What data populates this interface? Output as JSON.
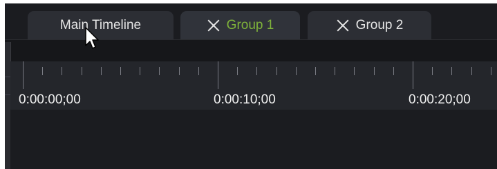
{
  "tabs": [
    {
      "label": "Main Timeline",
      "closable": false,
      "active": false
    },
    {
      "label": "Group 1",
      "closable": true,
      "active": true
    },
    {
      "label": "Group 2",
      "closable": true,
      "active": false
    }
  ],
  "ruler": {
    "time_labels": [
      "0:00:00;00",
      "0:00:10;00",
      "0:00:20;00"
    ]
  },
  "colors": {
    "active_tab_text": "#7fb33a",
    "tab_text": "#e6e6e6",
    "background": "#1b1c20",
    "ruler_background": "#24262b"
  },
  "icons": {
    "tab_close": "close-icon",
    "cursor": "mouse-pointer-icon"
  }
}
